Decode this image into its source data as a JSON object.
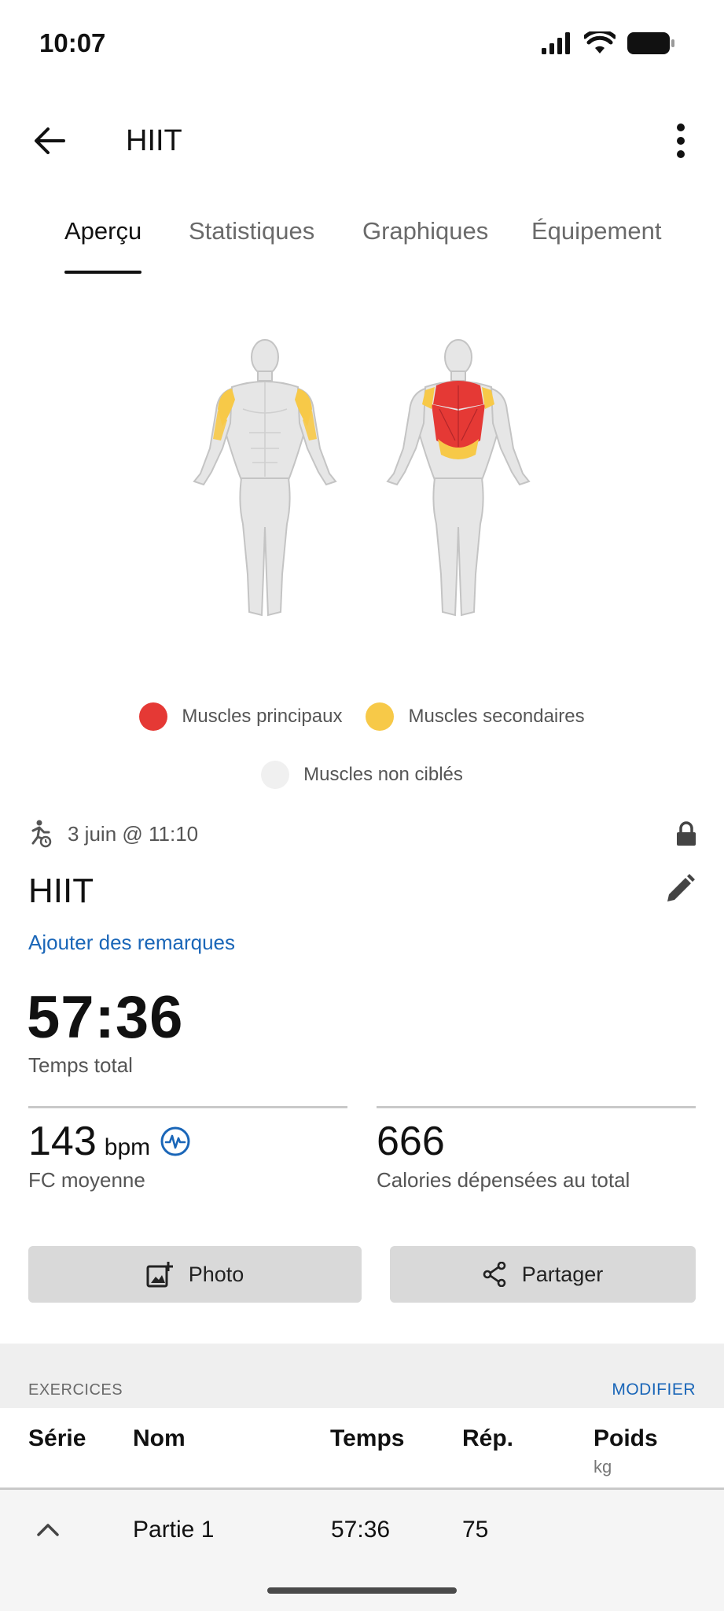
{
  "status_bar": {
    "time": "10:07"
  },
  "app_bar": {
    "title": "HIIT"
  },
  "tabs": [
    {
      "label": "Aperçu",
      "active": true
    },
    {
      "label": "Statistiques",
      "active": false
    },
    {
      "label": "Graphiques",
      "active": false
    },
    {
      "label": "Équipement",
      "active": false
    }
  ],
  "legend": {
    "primary": {
      "label": "Muscles principaux",
      "color": "#e53935"
    },
    "secondary": {
      "label": "Muscles secondaires",
      "color": "#f7c948"
    },
    "untargeted": {
      "label": "Muscles non ciblés",
      "color": "#f0f0f0"
    }
  },
  "workout": {
    "date": "3 juin @ 11:10",
    "title": "HIIT",
    "add_notes": "Ajouter des remarques",
    "total_time": "57:36",
    "total_time_label": "Temps total",
    "avg_hr": {
      "value": "143",
      "unit": "bpm",
      "label": "FC moyenne"
    },
    "calories": {
      "value": "666",
      "label": "Calories dépensées au total"
    }
  },
  "buttons": {
    "photo": "Photo",
    "share": "Partager"
  },
  "exercises": {
    "section_title": "EXERCICES",
    "edit_label": "MODIFIER",
    "columns": {
      "serie": "Série",
      "nom": "Nom",
      "temps": "Temps",
      "rep": "Rép.",
      "poids": "Poids",
      "poids_unit": "kg"
    },
    "rows": [
      {
        "nom": "Partie 1",
        "temps": "57:36",
        "rep": "75",
        "poids": ""
      }
    ]
  }
}
